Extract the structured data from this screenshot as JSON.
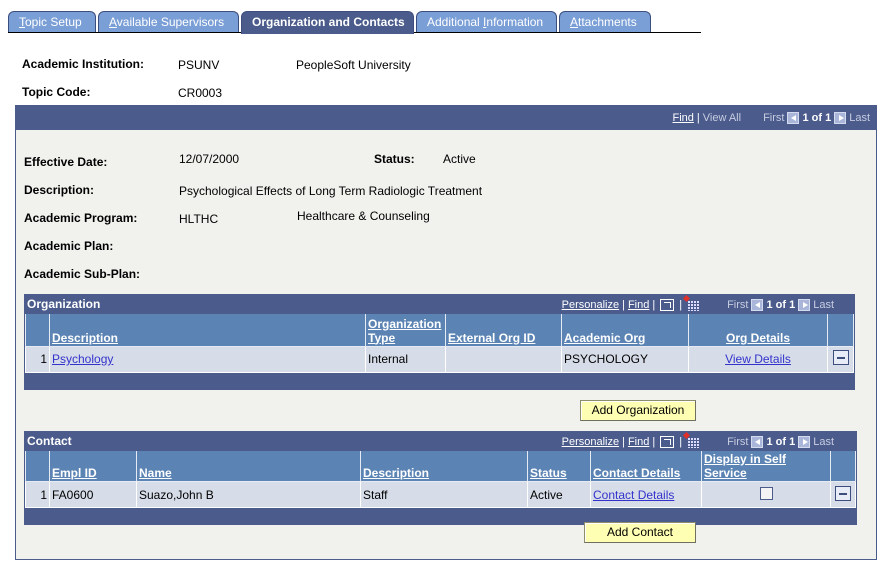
{
  "tabs": [
    {
      "label_pre": "",
      "accel": "T",
      "label_post": "opic Setup"
    },
    {
      "label_pre": "",
      "accel": "A",
      "label_post": "vailable Supervisors"
    },
    {
      "label_pre": "Organization and Contacts",
      "accel": "",
      "label_post": ""
    },
    {
      "label_pre": "Additional ",
      "accel": "I",
      "label_post": "nformation"
    },
    {
      "label_pre": "",
      "accel": "A",
      "label_post": "ttachments"
    }
  ],
  "header": {
    "institution_label": "Academic Institution:",
    "institution_code": "PSUNV",
    "institution_name": "PeopleSoft University",
    "topic_label": "Topic Code:",
    "topic_code": "CR0003"
  },
  "main_nav": {
    "find": "Find",
    "view_all": "View All",
    "first": "First",
    "count": "1 of 1",
    "last": "Last"
  },
  "fields": {
    "effective_date_label": "Effective Date:",
    "effective_date": "12/07/2000",
    "status_label": "Status:",
    "status": "Active",
    "description_label": "Description:",
    "description": "Psychological Effects of Long Term Radiologic Treatment",
    "program_label": "Academic Program:",
    "program_code": "HLTHC",
    "program_name": "Healthcare & Counseling",
    "plan_label": "Academic Plan:",
    "subplan_label": "Academic Sub-Plan:"
  },
  "organization": {
    "title": "Organization",
    "tools": {
      "personalize": "Personalize",
      "find": "Find",
      "first": "First",
      "count": "1 of 1",
      "last": "Last"
    },
    "columns": [
      "Description",
      "Organization Type",
      "External Org ID",
      "Academic Org",
      "Org Details"
    ],
    "rows": [
      {
        "num": "1",
        "description": "Psychology",
        "type": "Internal",
        "external_id": "",
        "academic_org": "PSYCHOLOGY",
        "details": "View Details"
      }
    ],
    "add_button": "Add Organization"
  },
  "contact": {
    "title": "Contact",
    "tools": {
      "personalize": "Personalize",
      "find": "Find",
      "first": "First",
      "count": "1 of 1",
      "last": "Last"
    },
    "columns": [
      "Empl ID",
      "Name",
      "Description",
      "Status",
      "Contact Details",
      "Display in Self Service"
    ],
    "rows": [
      {
        "num": "1",
        "emplid": "FA0600",
        "name": "Suazo,John B",
        "description": "Staff",
        "status": "Active",
        "details": "Contact Details",
        "self_service": false
      }
    ],
    "add_button": "Add Contact"
  }
}
